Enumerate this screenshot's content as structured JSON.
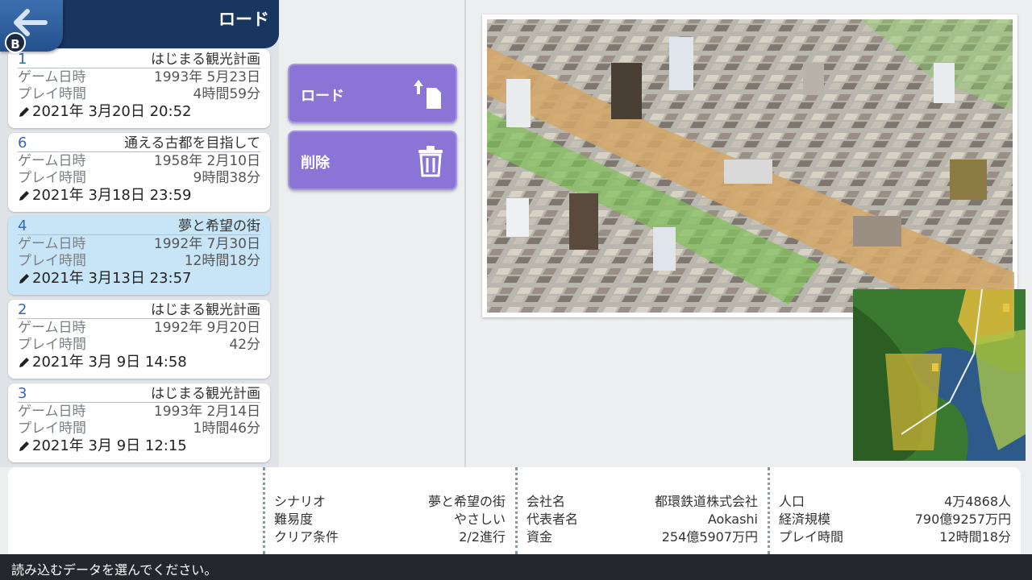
{
  "header": {
    "title": "ロード",
    "back_badge": "B"
  },
  "saves": [
    {
      "slot": "1",
      "name": "はじまる観光計画",
      "game_date_label": "ゲーム日時",
      "game_date": "1993年 5月23日",
      "play_time_label": "プレイ時間",
      "play_time": "4時間59分",
      "saved_at": "2021年 3月20日 20:52",
      "selected": false
    },
    {
      "slot": "6",
      "name": "通える古都を目指して",
      "game_date_label": "ゲーム日時",
      "game_date": "1958年 2月10日",
      "play_time_label": "プレイ時間",
      "play_time": "9時間38分",
      "saved_at": "2021年 3月18日 23:59",
      "selected": false
    },
    {
      "slot": "4",
      "name": "夢と希望の街",
      "game_date_label": "ゲーム日時",
      "game_date": "1992年 7月30日",
      "play_time_label": "プレイ時間",
      "play_time": "12時間18分",
      "saved_at": "2021年 3月13日 23:57",
      "selected": true
    },
    {
      "slot": "2",
      "name": "はじまる観光計画",
      "game_date_label": "ゲーム日時",
      "game_date": "1992年 9月20日",
      "play_time_label": "プレイ時間",
      "play_time": "42分",
      "saved_at": "2021年 3月 9日 14:58",
      "selected": false
    },
    {
      "slot": "3",
      "name": "はじまる観光計画",
      "game_date_label": "ゲーム日時",
      "game_date": "1993年 2月14日",
      "play_time_label": "プレイ時間",
      "play_time": "1時間46分",
      "saved_at": "2021年 3月 9日 12:15",
      "selected": false
    }
  ],
  "actions": {
    "load_label": "ロード",
    "delete_label": "削除"
  },
  "details": {
    "scenario": {
      "scenario_label": "シナリオ",
      "scenario": "夢と希望の街",
      "difficulty_label": "難易度",
      "difficulty": "やさしい",
      "clear_label": "クリア条件",
      "clear": "2/2進行"
    },
    "company": {
      "company_label": "会社名",
      "company": "都環鉄道株式会社",
      "rep_label": "代表者名",
      "rep": "Aokashi",
      "funds_label": "資金",
      "funds": "254億5907万円"
    },
    "city": {
      "population_label": "人口",
      "population": "4万4868人",
      "economy_label": "経済規模",
      "economy": "790億9257万円",
      "play_time_label": "プレイ時間",
      "play_time": "12時間18分"
    }
  },
  "status": {
    "message": "読み込むデータを選んでください。"
  },
  "colors": {
    "header": "#18365f",
    "action": "#8a74d6",
    "selected": "#c8e5f8",
    "status_bar": "#24282d"
  }
}
